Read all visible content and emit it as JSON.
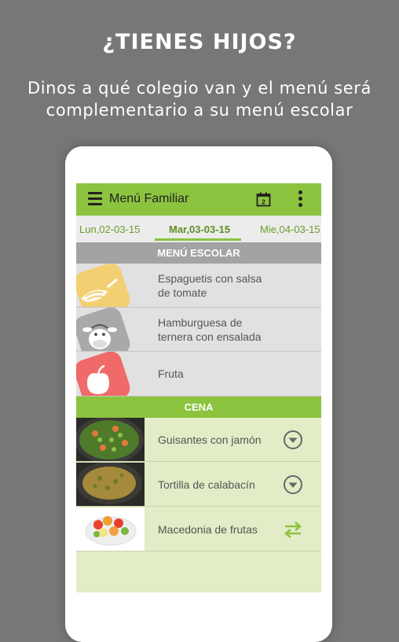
{
  "promo": {
    "headline": "¿TIENES HIJOS?",
    "subline_1": "Dinos a qué colegio van y el menú será",
    "subline_2": "complementario a su menú escolar"
  },
  "app": {
    "title": "Menú Familiar",
    "calendar_day": "2",
    "icons": [
      "menu-icon",
      "calendar-icon",
      "more-vert-icon"
    ],
    "accent_color": "#8cc33f"
  },
  "tabs": [
    {
      "label": "Lun,02-03-15",
      "active": false
    },
    {
      "label": "Mar,03-03-15",
      "active": true
    },
    {
      "label": "Mie,04-03-15",
      "active": false
    }
  ],
  "school_menu": {
    "heading": "MENÚ ESCOLAR",
    "items": [
      {
        "line1": "Espaguetis con salsa",
        "line2": "de tomate",
        "icon": "pasta-icon",
        "color": "#f3cf73"
      },
      {
        "line1": "Hamburguesa de",
        "line2": "ternera con ensalada",
        "icon": "cow-icon",
        "color": "#a9a9a9"
      },
      {
        "line1": "Fruta",
        "line2": "",
        "icon": "apple-icon",
        "color": "#f06a6a"
      }
    ]
  },
  "dinner": {
    "heading": "CENA",
    "items": [
      {
        "label": "Guisantes con jamón",
        "action": "expand-icon"
      },
      {
        "label": "Tortilla de calabacín",
        "action": "expand-icon"
      },
      {
        "label": "Macedonia de frutas",
        "action": "swap-icon"
      }
    ]
  }
}
